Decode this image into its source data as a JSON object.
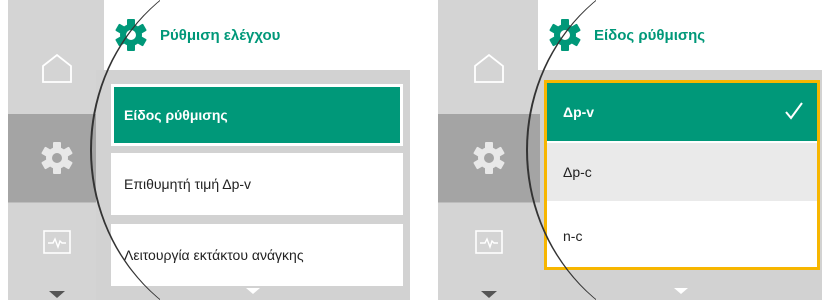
{
  "colors": {
    "accent": "#009879",
    "focus": "#f7b600",
    "panel": "#d2d2d2",
    "rail": "#d4d4d4",
    "rail_selected": "#a4a4a4"
  },
  "left_screen": {
    "header": {
      "icon": "gear-icon",
      "title": "Ρύθμιση ελέγχου"
    },
    "rail": [
      {
        "icon": "home-icon",
        "selected": false
      },
      {
        "icon": "gear-icon",
        "selected": true
      },
      {
        "icon": "pulse-monitor-icon",
        "selected": false
      }
    ],
    "menu_items": [
      {
        "label": "Είδος ρύθμισης",
        "selected": true
      },
      {
        "label": "Επιθυμητή τιμή Δp-v",
        "selected": false
      },
      {
        "label": "Λειτουργία εκτάκτου ανάγκης",
        "selected": false
      }
    ]
  },
  "right_screen": {
    "header": {
      "icon": "gear-icon",
      "title": "Είδος ρύθμισης"
    },
    "rail": [
      {
        "icon": "home-icon",
        "selected": false
      },
      {
        "icon": "gear-icon",
        "selected": true
      },
      {
        "icon": "pulse-monitor-icon",
        "selected": false
      }
    ],
    "options": [
      {
        "label": "Δp-v",
        "selected": true,
        "check_icon": "checkmark-icon"
      },
      {
        "label": "Δp-c",
        "selected": false
      },
      {
        "label": "n-c",
        "selected": false
      }
    ]
  }
}
